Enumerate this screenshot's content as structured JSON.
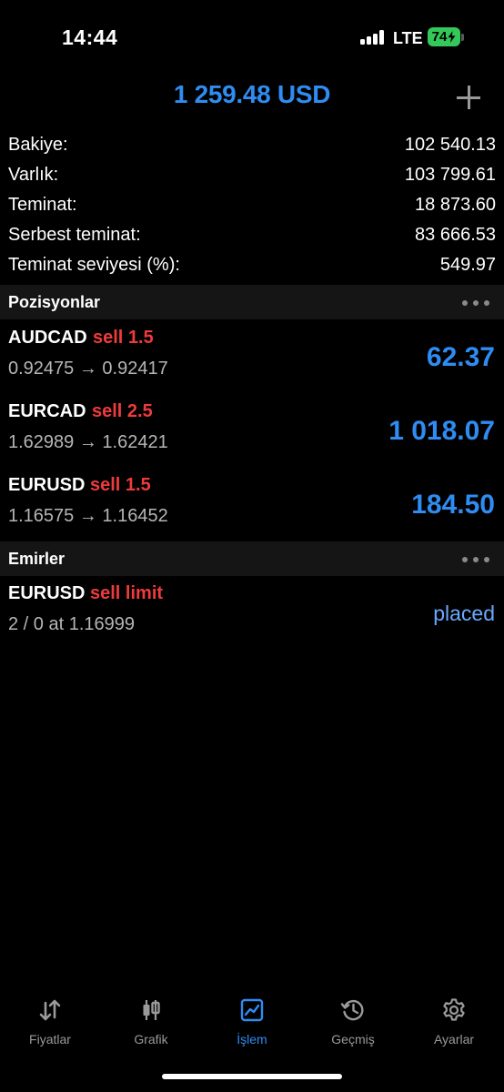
{
  "status_bar": {
    "time": "14:44",
    "network": "LTE",
    "battery": "74"
  },
  "header": {
    "total": "1 259.48 USD",
    "add_icon": "plus-icon"
  },
  "account": [
    {
      "label": "Bakiye:",
      "value": "102 540.13"
    },
    {
      "label": "Varlık:",
      "value": "103 799.61"
    },
    {
      "label": "Teminat:",
      "value": "18 873.60"
    },
    {
      "label": "Serbest teminat:",
      "value": "83 666.53"
    },
    {
      "label": "Teminat seviyesi (%):",
      "value": "549.97"
    }
  ],
  "positions_header": {
    "title": "Pozisyonlar",
    "menu_icon": "more-dots-icon"
  },
  "positions": [
    {
      "symbol": "AUDCAD",
      "side": "sell 1.5",
      "prices": "0.92475 → 0.92417",
      "profit": "62.37"
    },
    {
      "symbol": "EURCAD",
      "side": "sell 2.5",
      "prices": "1.62989 → 1.62421",
      "profit": "1 018.07"
    },
    {
      "symbol": "EURUSD",
      "side": "sell 1.5",
      "prices": "1.16575 → 1.16452",
      "profit": "184.50"
    }
  ],
  "orders_header": {
    "title": "Emirler",
    "menu_icon": "more-dots-icon"
  },
  "orders": [
    {
      "symbol": "EURUSD",
      "side": "sell limit",
      "details": "2 / 0 at 1.16999",
      "state": "placed"
    }
  ],
  "tabs": [
    {
      "label": "Fiyatlar",
      "icon": "quotes-arrows-icon",
      "active": false
    },
    {
      "label": "Grafik",
      "icon": "candlestick-chart-icon",
      "active": false
    },
    {
      "label": "İşlem",
      "icon": "trade-chart-icon",
      "active": true
    },
    {
      "label": "Geçmiş",
      "icon": "history-clock-icon",
      "active": false
    },
    {
      "label": "Ayarlar",
      "icon": "gear-icon",
      "active": false
    }
  ],
  "colors": {
    "accent_blue": "#2f8cf2",
    "sell_red": "#ef3b3b",
    "placed_blue": "#6aa9ff",
    "battery_green": "#34c759",
    "background": "#000000",
    "section_bg": "#151515"
  }
}
